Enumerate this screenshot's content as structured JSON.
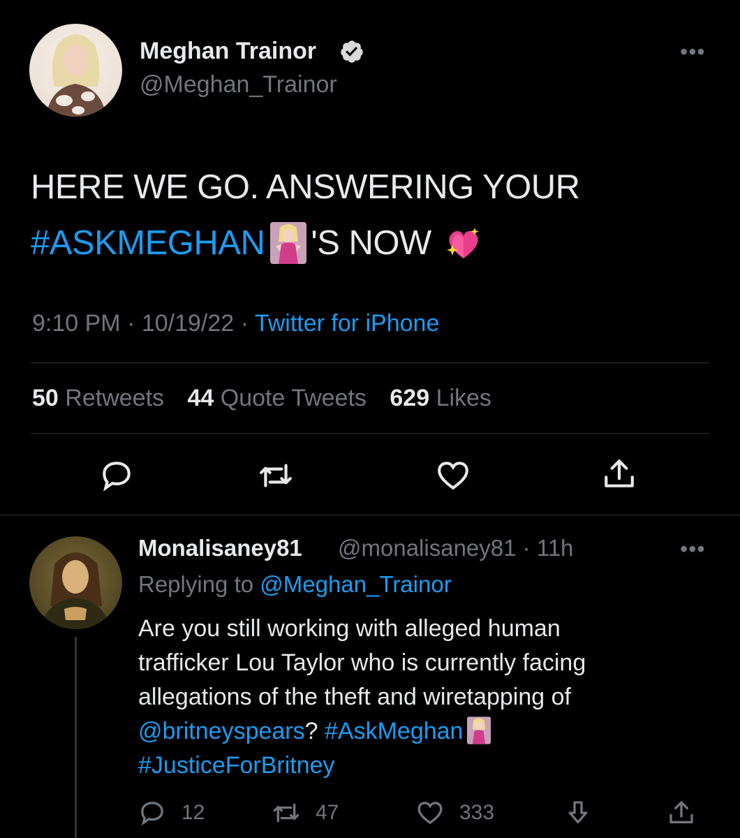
{
  "main_tweet": {
    "author": {
      "display_name": "Meghan Trainor",
      "handle": "@Meghan_Trainor",
      "verified": true
    },
    "text": {
      "line1": "HERE WE GO. ANSWERING YOUR",
      "hashtag": "#ASKMEGHAN",
      "line2_rest": "'S NOW"
    },
    "meta": {
      "time": "9:10 PM",
      "date": "10/19/22",
      "source": "Twitter for iPhone"
    },
    "stats": {
      "retweets_count": "50",
      "retweets_label": "Retweets",
      "quote_count": "44",
      "quote_label": "Quote Tweets",
      "likes_count": "629",
      "likes_label": "Likes"
    }
  },
  "reply_tweet": {
    "author": {
      "display_name": "Monalisaney81",
      "handle_time": "@monalisaney81 · 11h"
    },
    "replying_prefix": "Replying to",
    "replying_to": "@Meghan_Trainor",
    "text": {
      "l1": "Are you still working with alleged human",
      "l2": "trafficker Lou Taylor who is currently facing",
      "l3": "allegations of the theft and wiretapping of",
      "mention": "@britneyspears",
      "q": "?",
      "hashtag1": "#AskMeghan",
      "hashtag2": "#JusticeForBritney"
    },
    "actions": {
      "replies": "12",
      "retweets": "47",
      "likes": "333"
    }
  },
  "colors": {
    "background": "#000000",
    "text": "#e7e9ea",
    "secondary": "#71767b",
    "link": "#1d9bf0",
    "divider": "#2f3336"
  },
  "icons": [
    "verified-badge-icon",
    "more-icon",
    "reply-icon",
    "retweet-icon",
    "like-icon",
    "share-icon",
    "downvote-icon",
    "sparkling-heart-emoji",
    "dancer-emoji"
  ]
}
